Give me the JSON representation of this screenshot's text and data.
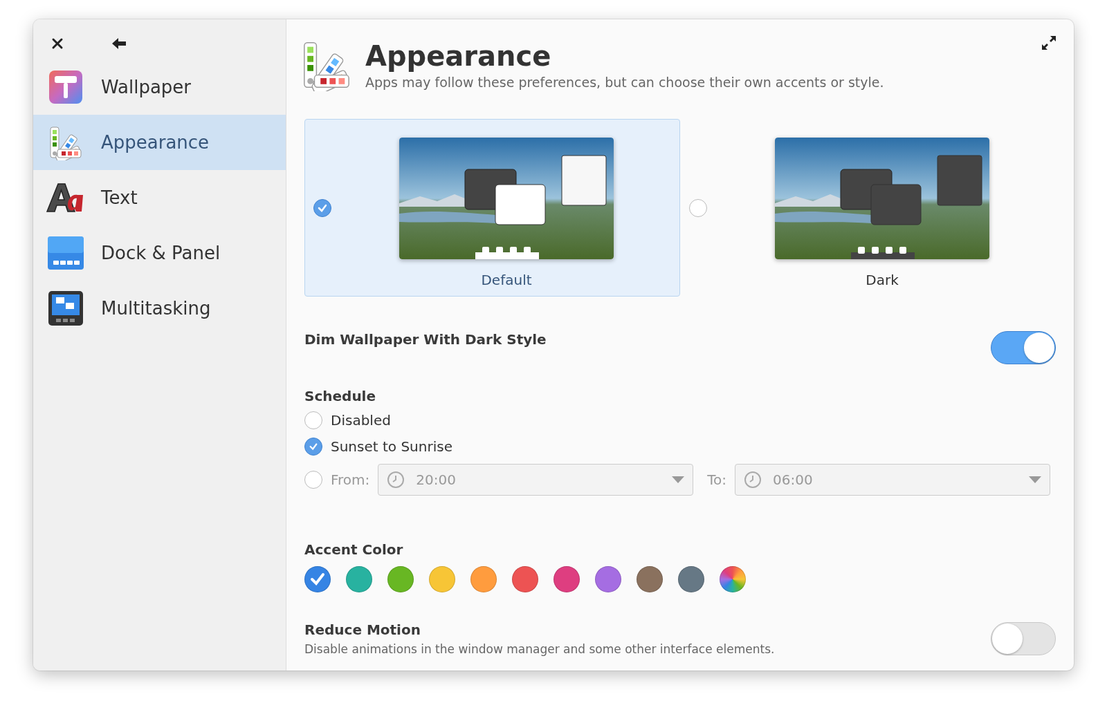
{
  "sidebar": {
    "items": [
      {
        "label": "Wallpaper",
        "kind": "wallpaper",
        "selected": false
      },
      {
        "label": "Appearance",
        "kind": "appearance",
        "selected": true
      },
      {
        "label": "Text",
        "kind": "text",
        "selected": false
      },
      {
        "label": "Dock & Panel",
        "kind": "dock",
        "selected": false
      },
      {
        "label": "Multitasking",
        "kind": "multitasking",
        "selected": false
      }
    ]
  },
  "header": {
    "title": "Appearance",
    "subtitle": "Apps may follow these preferences, but can choose their own accents or style."
  },
  "styles": [
    {
      "label": "Default",
      "kind": "light",
      "selected": true
    },
    {
      "label": "Dark",
      "kind": "dark",
      "selected": false
    }
  ],
  "dim_wallpaper": {
    "label": "Dim Wallpaper With Dark Style",
    "on": true
  },
  "schedule": {
    "title": "Schedule",
    "options": [
      {
        "label": "Disabled",
        "kind": "plain",
        "selected": false
      },
      {
        "label": "Sunset to Sunrise",
        "kind": "plain",
        "selected": true
      },
      {
        "label": "From:",
        "kind": "range",
        "selected": false,
        "from": "20:00",
        "to_label": "To:",
        "to": "06:00"
      }
    ]
  },
  "accent": {
    "title": "Accent Color",
    "colors": [
      {
        "kind": "solid",
        "color": "#3584e4",
        "selected": true
      },
      {
        "kind": "solid",
        "color": "#28b2a0",
        "selected": false
      },
      {
        "kind": "solid",
        "color": "#68b723",
        "selected": false
      },
      {
        "kind": "solid",
        "color": "#f7c536",
        "selected": false
      },
      {
        "kind": "solid",
        "color": "#ff9c3e",
        "selected": false
      },
      {
        "kind": "solid",
        "color": "#ed5353",
        "selected": false
      },
      {
        "kind": "solid",
        "color": "#de3e80",
        "selected": false
      },
      {
        "kind": "solid",
        "color": "#a56de2",
        "selected": false
      },
      {
        "kind": "solid",
        "color": "#8a715e",
        "selected": false
      },
      {
        "kind": "solid",
        "color": "#667885",
        "selected": false
      },
      {
        "kind": "multi",
        "selected": false
      }
    ]
  },
  "reduce_motion": {
    "label": "Reduce Motion",
    "description": "Disable animations in the window manager and some other interface elements.",
    "on": false
  }
}
